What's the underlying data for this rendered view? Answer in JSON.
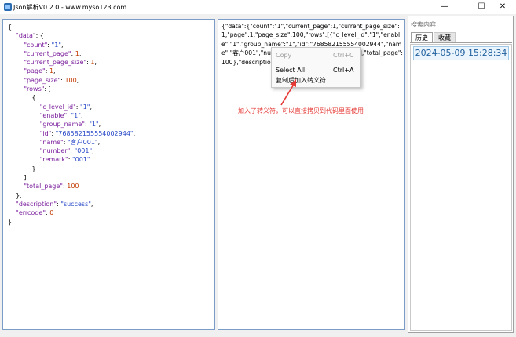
{
  "window": {
    "title": "Json解析V0.2.0 - www.myso123.com",
    "minimize_glyph": "—",
    "maximize_glyph": "☐",
    "close_glyph": "✕"
  },
  "json_view": {
    "lines": [
      [
        [
          "p",
          "{"
        ]
      ],
      [
        [
          "p",
          "    "
        ],
        [
          "k",
          "\"data\""
        ],
        [
          "p",
          ": {"
        ]
      ],
      [
        [
          "p",
          "        "
        ],
        [
          "k",
          "\"count\""
        ],
        [
          "p",
          ": "
        ],
        [
          "s",
          "\"1\""
        ],
        [
          "p",
          ","
        ]
      ],
      [
        [
          "p",
          "        "
        ],
        [
          "k",
          "\"current_page\""
        ],
        [
          "p",
          ": "
        ],
        [
          "n",
          "1"
        ],
        [
          "p",
          ","
        ]
      ],
      [
        [
          "p",
          "        "
        ],
        [
          "k",
          "\"current_page_size\""
        ],
        [
          "p",
          ": "
        ],
        [
          "n",
          "1"
        ],
        [
          "p",
          ","
        ]
      ],
      [
        [
          "p",
          "        "
        ],
        [
          "k",
          "\"page\""
        ],
        [
          "p",
          ": "
        ],
        [
          "n",
          "1"
        ],
        [
          "p",
          ","
        ]
      ],
      [
        [
          "p",
          "        "
        ],
        [
          "k",
          "\"page_size\""
        ],
        [
          "p",
          ": "
        ],
        [
          "n",
          "100"
        ],
        [
          "p",
          ","
        ]
      ],
      [
        [
          "p",
          "        "
        ],
        [
          "k",
          "\"rows\""
        ],
        [
          "p",
          ": ["
        ]
      ],
      [
        [
          "p",
          "            {"
        ]
      ],
      [
        [
          "p",
          "                "
        ],
        [
          "k",
          "\"c_level_id\""
        ],
        [
          "p",
          ": "
        ],
        [
          "s",
          "\"1\""
        ],
        [
          "p",
          ","
        ]
      ],
      [
        [
          "p",
          "                "
        ],
        [
          "k",
          "\"enable\""
        ],
        [
          "p",
          ": "
        ],
        [
          "s",
          "\"1\""
        ],
        [
          "p",
          ","
        ]
      ],
      [
        [
          "p",
          "                "
        ],
        [
          "k",
          "\"group_name\""
        ],
        [
          "p",
          ": "
        ],
        [
          "s",
          "\"1\""
        ],
        [
          "p",
          ","
        ]
      ],
      [
        [
          "p",
          "                "
        ],
        [
          "k",
          "\"id\""
        ],
        [
          "p",
          ": "
        ],
        [
          "s",
          "\"768582155554002944\""
        ],
        [
          "p",
          ","
        ]
      ],
      [
        [
          "p",
          "                "
        ],
        [
          "k",
          "\"name\""
        ],
        [
          "p",
          ": "
        ],
        [
          "s",
          "\"客户001\""
        ],
        [
          "p",
          ","
        ]
      ],
      [
        [
          "p",
          "                "
        ],
        [
          "k",
          "\"number\""
        ],
        [
          "p",
          ": "
        ],
        [
          "s",
          "\"001\""
        ],
        [
          "p",
          ","
        ]
      ],
      [
        [
          "p",
          "                "
        ],
        [
          "k",
          "\"remark\""
        ],
        [
          "p",
          ": "
        ],
        [
          "s",
          "\"001\""
        ]
      ],
      [
        [
          "p",
          "            }"
        ]
      ],
      [
        [
          "p",
          "        ],"
        ]
      ],
      [
        [
          "p",
          "        "
        ],
        [
          "k",
          "\"total_page\""
        ],
        [
          "p",
          ": "
        ],
        [
          "n",
          "100"
        ]
      ],
      [
        [
          "p",
          "    },"
        ]
      ],
      [
        [
          "p",
          "    "
        ],
        [
          "k",
          "\"description\""
        ],
        [
          "p",
          ": "
        ],
        [
          "s",
          "\"success\""
        ],
        [
          "p",
          ","
        ]
      ],
      [
        [
          "p",
          "    "
        ],
        [
          "k",
          "\"errcode\""
        ],
        [
          "p",
          ": "
        ],
        [
          "n",
          "0"
        ]
      ],
      [
        [
          "p",
          "}"
        ]
      ]
    ]
  },
  "raw_view": {
    "text": "{\"data\":{\"count\":\"1\",\"current_page\":1,\"current_page_size\":1,\"page\":1,\"page_size\":100,\"rows\":[{\"c_level_id\":\"1\",\"enable\":\"1\",\"group_name\":\"1\",\"id\":\"768582155554002944\",\"name\":\"客户001\",\"number\":\"001\",\"remark\":\"001\"}],\"total_page\":100},\"description\":\"success\",\"errcode\":0}"
  },
  "context_menu": {
    "copy_label": "Copy",
    "copy_shortcut": "Ctrl+C",
    "select_all_label": "Select All",
    "select_all_shortcut": "Ctrl+A",
    "copy_escaped_label": "复制后加入转义符"
  },
  "annotation": {
    "text": "加入了转义符，可以直接拷贝到代码里面使用",
    "color": "#e53935"
  },
  "sidebar": {
    "search_placeholder": "搜索内容",
    "tabs": [
      "历史",
      "收藏"
    ],
    "history_items": [
      "2024-05-09 15:28:34"
    ]
  }
}
